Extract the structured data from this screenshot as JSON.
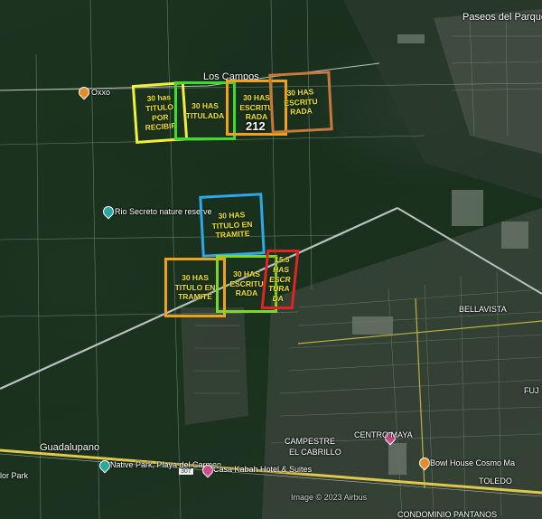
{
  "map_labels": {
    "paseos": "Paseos del Parque",
    "los_campos": "Los Campos",
    "oxxo": "Oxxo",
    "rio_secreto": "Rio Secreto nature reserve",
    "bellavista": "BELLAVISTA",
    "guadalupano": "Guadalupano",
    "campestre": "CAMPESTRE",
    "el_cabrillo": "EL CABRILLO",
    "centro_maya": "CENTRO MAYA",
    "native_park": "Native Park, Playa del Carmen",
    "casa_kabah": "Casa Kabah Hotel & Suites",
    "lor_park": "lor Park",
    "route_307": "307",
    "image_copyright": "Image © 2023 Airbus",
    "condominio": "CONDOMINIO PANTANOS",
    "bowl_house": "Bowl House Cosmo Ma",
    "fuj": "FUJ",
    "toledo": "TOLEDO"
  },
  "parcels": [
    {
      "id": "p1",
      "label": "30 has\nTITULO\nPOR\nRECIBIR",
      "color": "#f2ef3a"
    },
    {
      "id": "p2",
      "label": "30 HAS\nTITULADA",
      "color": "#3ddc2a"
    },
    {
      "id": "p3",
      "label": "30 HAS\nESCRITU\nRADA",
      "color": "#f0a21e"
    },
    {
      "id": "p4",
      "label": "30 HAS\nESCRITU\nRADA",
      "color": "#c8783a"
    },
    {
      "id": "p5",
      "label": "30 HAS\nTITULO EN\nTRAMITE",
      "color": "#2ea8e8"
    },
    {
      "id": "p6",
      "label": "30 HAS\nTITULO EN\nTRAMITE",
      "color": "#f0a21e"
    },
    {
      "id": "p7",
      "label": "30 HAS\nESCRITU\nRADA",
      "color": "#7fd62a"
    },
    {
      "id": "p8",
      "label": "15.5\nHAS\nESCR\nTURA\nDA",
      "color": "#e02424"
    }
  ],
  "parcel_number": "212"
}
